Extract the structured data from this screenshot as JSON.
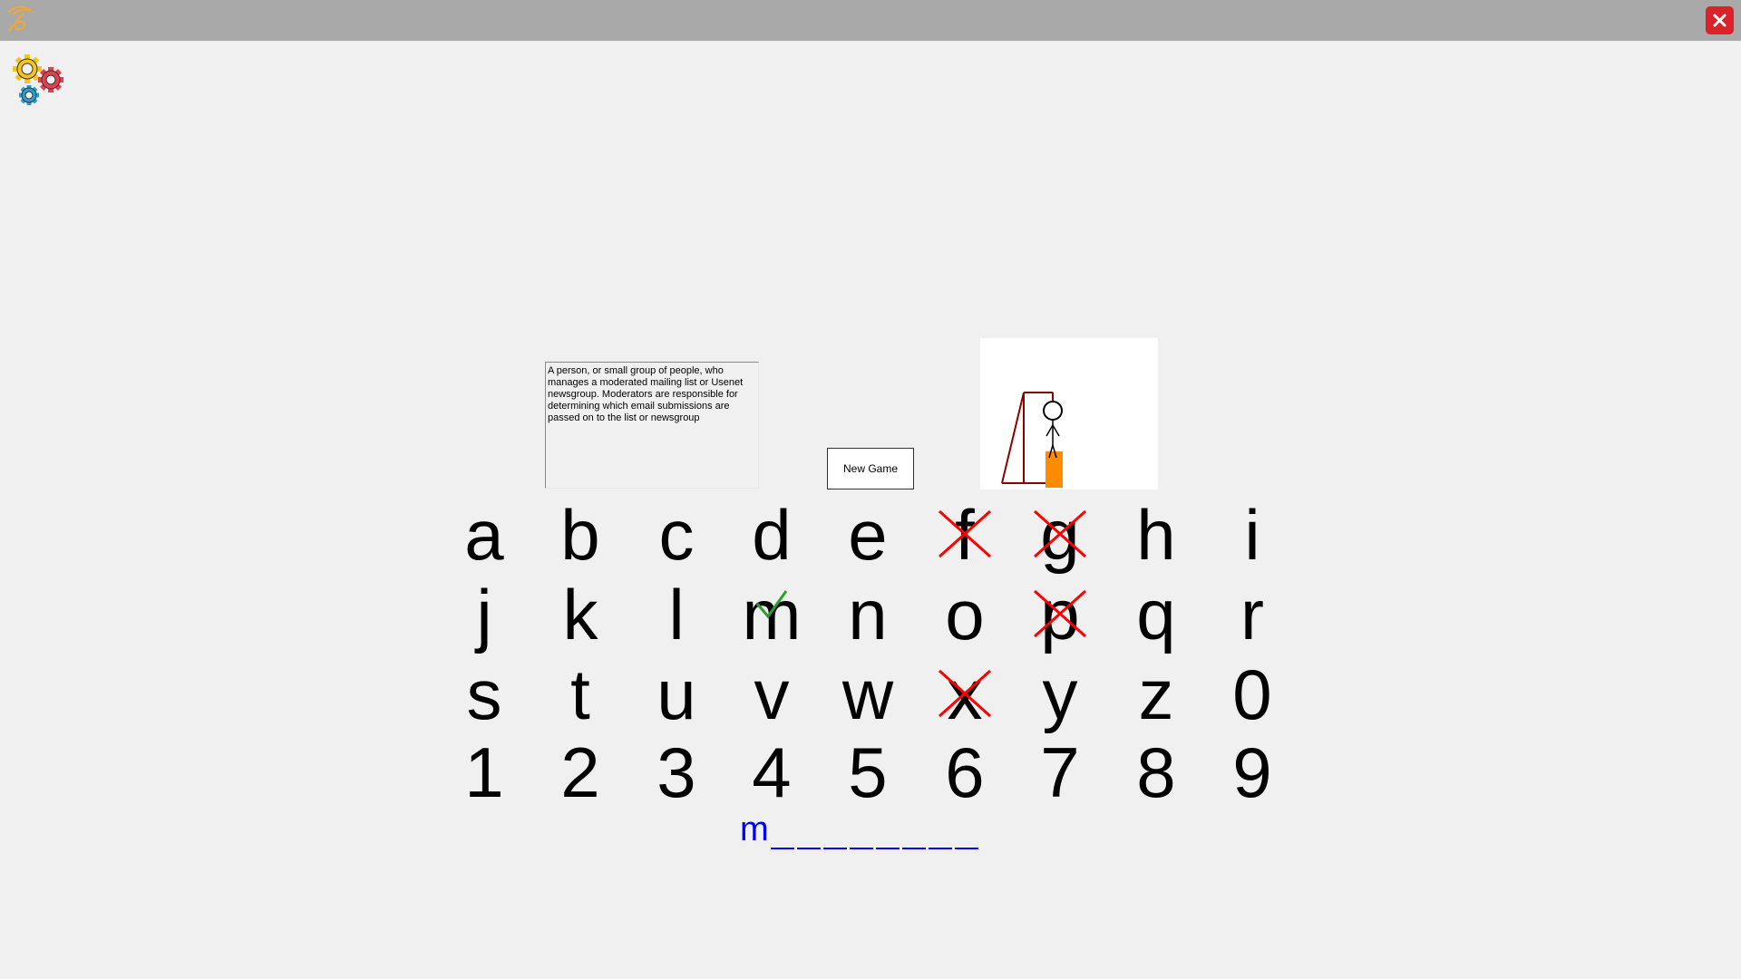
{
  "app": {
    "logo": "feather-logo-icon",
    "close": "close-icon",
    "settings": "gears-settings-icon"
  },
  "hint": "A person, or small group of people, who manages a moderated mailing list or Usenet newsgroup. Moderators are responsible for determining which email submissions are passed on to the list or newsgroup",
  "new_game_label": "New Game",
  "keys": [
    {
      "ch": "a",
      "state": "unused"
    },
    {
      "ch": "b",
      "state": "unused"
    },
    {
      "ch": "c",
      "state": "unused"
    },
    {
      "ch": "d",
      "state": "unused"
    },
    {
      "ch": "e",
      "state": "unused"
    },
    {
      "ch": "f",
      "state": "wrong"
    },
    {
      "ch": "g",
      "state": "wrong"
    },
    {
      "ch": "h",
      "state": "unused"
    },
    {
      "ch": "i",
      "state": "unused"
    },
    {
      "ch": "j",
      "state": "unused"
    },
    {
      "ch": "k",
      "state": "unused"
    },
    {
      "ch": "l",
      "state": "unused"
    },
    {
      "ch": "m",
      "state": "correct"
    },
    {
      "ch": "n",
      "state": "unused"
    },
    {
      "ch": "o",
      "state": "unused"
    },
    {
      "ch": "p",
      "state": "wrong"
    },
    {
      "ch": "q",
      "state": "unused"
    },
    {
      "ch": "r",
      "state": "unused"
    },
    {
      "ch": "s",
      "state": "unused"
    },
    {
      "ch": "t",
      "state": "unused"
    },
    {
      "ch": "u",
      "state": "unused"
    },
    {
      "ch": "v",
      "state": "unused"
    },
    {
      "ch": "w",
      "state": "unused"
    },
    {
      "ch": "x",
      "state": "wrong"
    },
    {
      "ch": "y",
      "state": "unused"
    },
    {
      "ch": "z",
      "state": "unused"
    },
    {
      "ch": "0",
      "state": "unused"
    },
    {
      "ch": "1",
      "state": "unused"
    },
    {
      "ch": "2",
      "state": "unused"
    },
    {
      "ch": "3",
      "state": "unused"
    },
    {
      "ch": "4",
      "state": "unused"
    },
    {
      "ch": "5",
      "state": "unused"
    },
    {
      "ch": "6",
      "state": "unused"
    },
    {
      "ch": "7",
      "state": "unused"
    },
    {
      "ch": "8",
      "state": "unused"
    },
    {
      "ch": "9",
      "state": "unused"
    }
  ],
  "word": {
    "revealed": "m",
    "blank_count": 8
  },
  "colors": {
    "wrong": "#ff0000",
    "correct": "#2aa02a",
    "word": "#0000ff",
    "gallows": "#8b0000",
    "stand": "#ff8c00"
  }
}
